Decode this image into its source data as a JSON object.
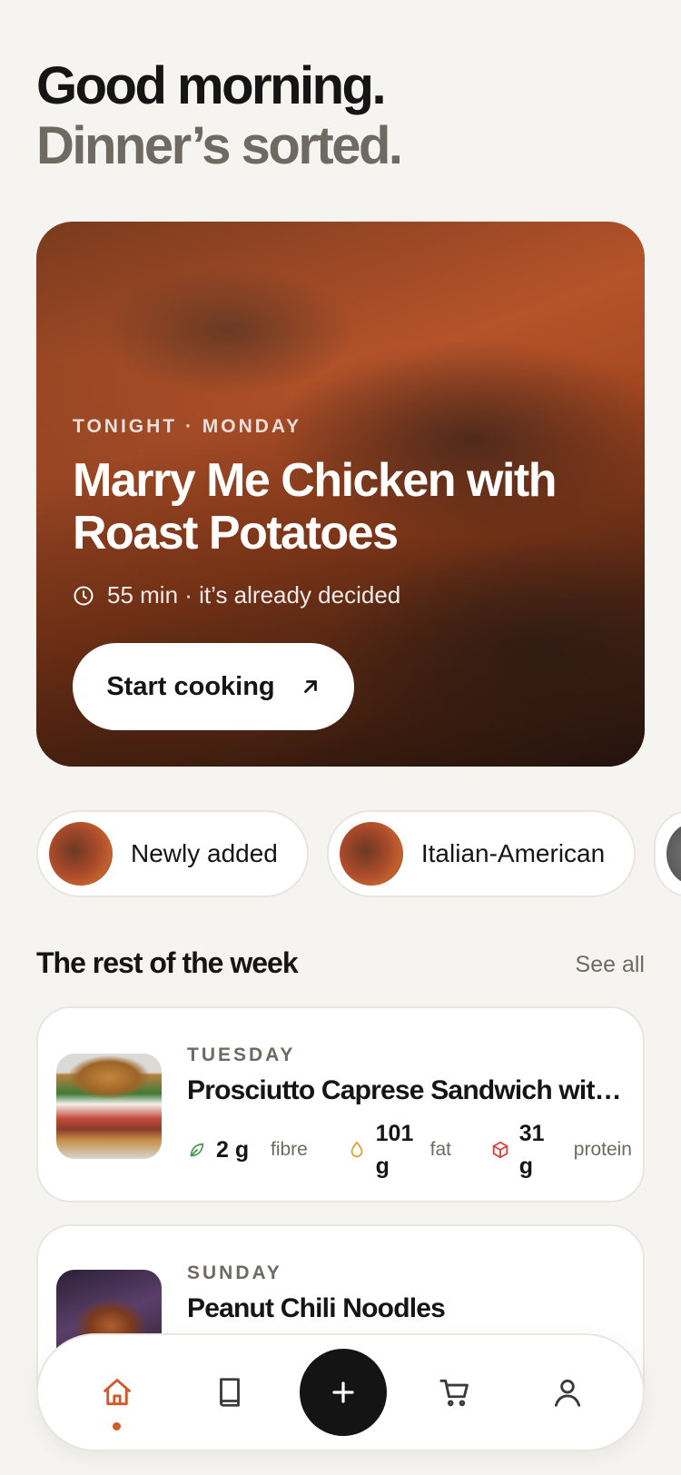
{
  "greeting": {
    "line1": "Good morning.",
    "line2": "Dinner’s sorted."
  },
  "hero": {
    "kicker": "TONIGHT · MONDAY",
    "title": "Marry Me Chicken with Roast Potatoes",
    "meta": "55 min · it’s already decided",
    "cta_label": "Start cooking",
    "accent": "#b5532a"
  },
  "chips": [
    {
      "label": "Newly added"
    },
    {
      "label": "Italian-American"
    }
  ],
  "week": {
    "title": "The rest of the week",
    "see_all": "See all",
    "cards": [
      {
        "day": "TUESDAY",
        "name": "Prosciutto Caprese Sandwich with ...",
        "macros": [
          {
            "value": "2 g",
            "label": "fibre",
            "icon": "leaf-icon",
            "color": "#4a9d54"
          },
          {
            "value": "101 g",
            "label": "fat",
            "icon": "drop-icon",
            "color": "#e0a43a"
          },
          {
            "value": "31 g",
            "label": "protein",
            "icon": "cube-icon",
            "color": "#d9403a"
          }
        ]
      },
      {
        "day": "SUNDAY",
        "name": "Peanut Chili Noodles"
      }
    ]
  },
  "nav": {
    "items": [
      "home-icon",
      "book-icon",
      "plus-icon",
      "cart-icon",
      "profile-icon"
    ],
    "active": "home",
    "active_color": "#d05a2b"
  }
}
